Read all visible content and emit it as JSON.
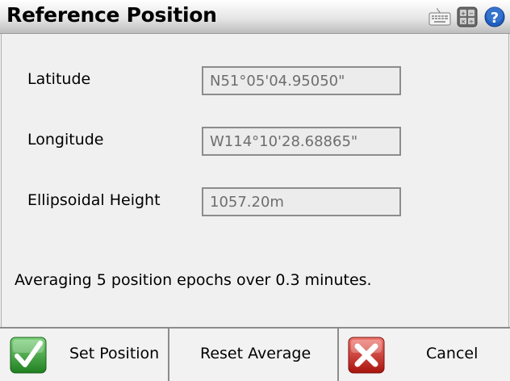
{
  "window": {
    "title": "Reference Position",
    "icons": [
      "keyboard-icon",
      "calculator-icon",
      "help-icon"
    ]
  },
  "fields": [
    {
      "label": "Latitude",
      "value": "N51°05'04.95050\""
    },
    {
      "label": "Longitude",
      "value": "W114°10'28.68865\""
    },
    {
      "label": "Ellipsoidal Height",
      "value": "1057.20m"
    }
  ],
  "status": {
    "text": "Averaging 5 position epochs over 0.3 minutes."
  },
  "buttons": {
    "set_position": {
      "label": "Set Position",
      "icon": "checkmark-icon"
    },
    "reset_average": {
      "label": "Reset Average"
    },
    "cancel": {
      "label": "Cancel",
      "icon": "x-icon"
    }
  },
  "colors": {
    "help_blue": "#1f5fbf",
    "check_green": "#2f9a2f",
    "cancel_red": "#d0241c"
  }
}
